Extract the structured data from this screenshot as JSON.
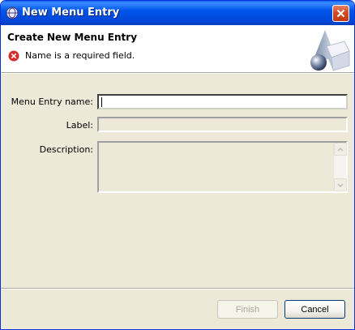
{
  "window": {
    "title": "New Menu Entry"
  },
  "header": {
    "title": "Create New Menu Entry",
    "error_message": "Name is a required field."
  },
  "form": {
    "name_label": "Menu Entry name:",
    "name_value": "",
    "label_label": "Label:",
    "label_value": "",
    "description_label": "Description:",
    "description_value": ""
  },
  "buttons": {
    "finish_label": "Finish",
    "finish_enabled": false,
    "cancel_label": "Cancel"
  },
  "colors": {
    "titlebar": "#0055ea",
    "error": "#d22f2f",
    "dialog_bg": "#ece9d8"
  }
}
